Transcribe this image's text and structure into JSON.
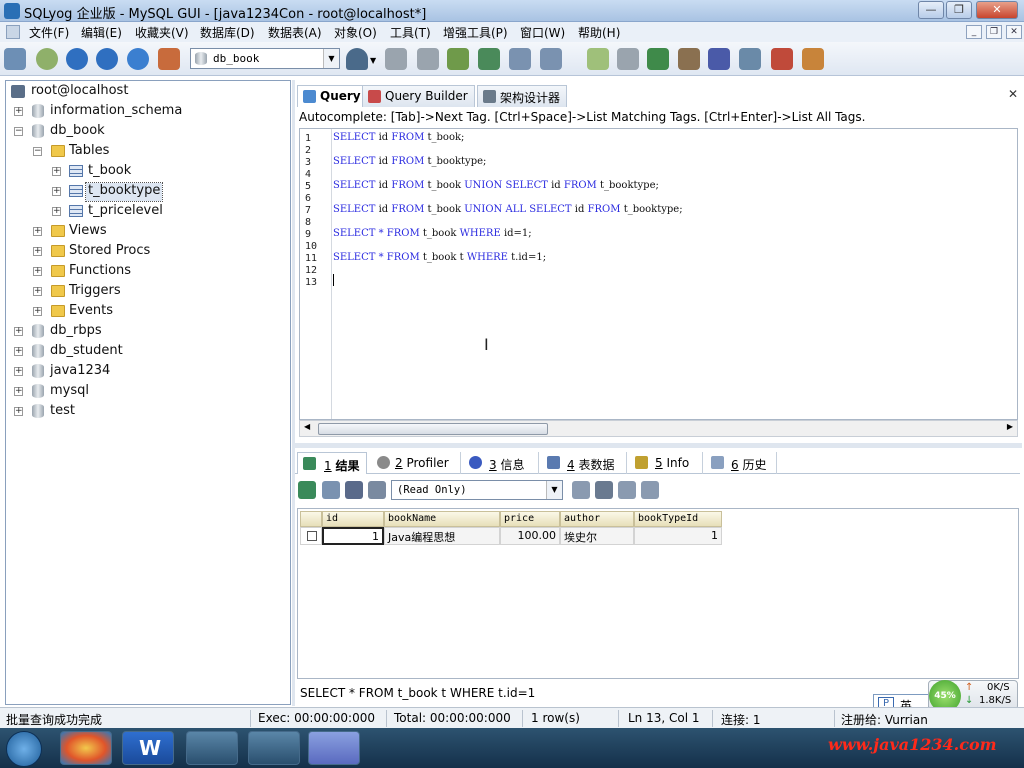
{
  "window": {
    "title": "SQLyog 企业版 - MySQL GUI - [java1234Con - root@localhost*]"
  },
  "menu": [
    "文件(F)",
    "编辑(E)",
    "收藏夹(V)",
    "数据库(D)",
    "数据表(A)",
    "对象(O)",
    "工具(T)",
    "增强工具(P)",
    "窗口(W)",
    "帮助(H)"
  ],
  "toolbar": {
    "db_select": "db_book"
  },
  "tree": {
    "root": "root@localhost",
    "nodes": [
      "information_schema",
      "db_book",
      "Tables",
      "t_book",
      "t_booktype",
      "t_pricelevel",
      "Views",
      "Stored Procs",
      "Functions",
      "Triggers",
      "Events",
      "db_rbps",
      "db_student",
      "java1234",
      "mysql",
      "test"
    ]
  },
  "query_tabs": [
    "Query",
    "Query Builder",
    "架构设计器"
  ],
  "autocomplete_hint": "Autocomplete: [Tab]->Next Tag. [Ctrl+Space]->List Matching Tags. [Ctrl+Enter]->List All Tags.",
  "editor": {
    "line_numbers": [
      "1",
      "2",
      "3",
      "4",
      "5",
      "6",
      "7",
      "8",
      "9",
      "10",
      "11",
      "12",
      "13"
    ],
    "lines": [
      "SELECT id FROM t_book;",
      "",
      "SELECT id FROM t_booktype;",
      "",
      "SELECT id FROM t_book UNION SELECT id FROM t_booktype;",
      "",
      "SELECT id FROM t_book UNION ALL SELECT id FROM t_booktype;",
      "",
      "SELECT * FROM t_book WHERE id=1;",
      "",
      "SELECT * FROM t_book t WHERE t.id=1;",
      "",
      ""
    ]
  },
  "result_tabs": [
    {
      "num": "1",
      "label": "结果"
    },
    {
      "num": "2",
      "label": "Profiler"
    },
    {
      "num": "3",
      "label": "信息"
    },
    {
      "num": "4",
      "label": "表数据"
    },
    {
      "num": "5",
      "label": "Info"
    },
    {
      "num": "6",
      "label": "历史"
    }
  ],
  "result_mode": "(Read Only)",
  "grid": {
    "columns": [
      "id",
      "bookName",
      "price",
      "author",
      "bookTypeId"
    ],
    "rows": [
      [
        "1",
        "Java编程思想",
        "100.00",
        "埃史尔",
        "1"
      ]
    ]
  },
  "status_query": "SELECT * FROM t_book t WHERE t.id=1",
  "statusbar": {
    "message": "批量查询成功完成",
    "exec": "Exec: 00:00:00:000",
    "total": "Total: 00:00:00:000",
    "rows": "1 row(s)",
    "position": "Ln 13, Col 1",
    "connection": "连接: 1",
    "registered": "注册给: Vurrian"
  },
  "tray": {
    "ime": "英",
    "cpu": "45%",
    "upload": "0K/S",
    "download": "1.8K/S"
  },
  "watermark": "www.java1234.com"
}
